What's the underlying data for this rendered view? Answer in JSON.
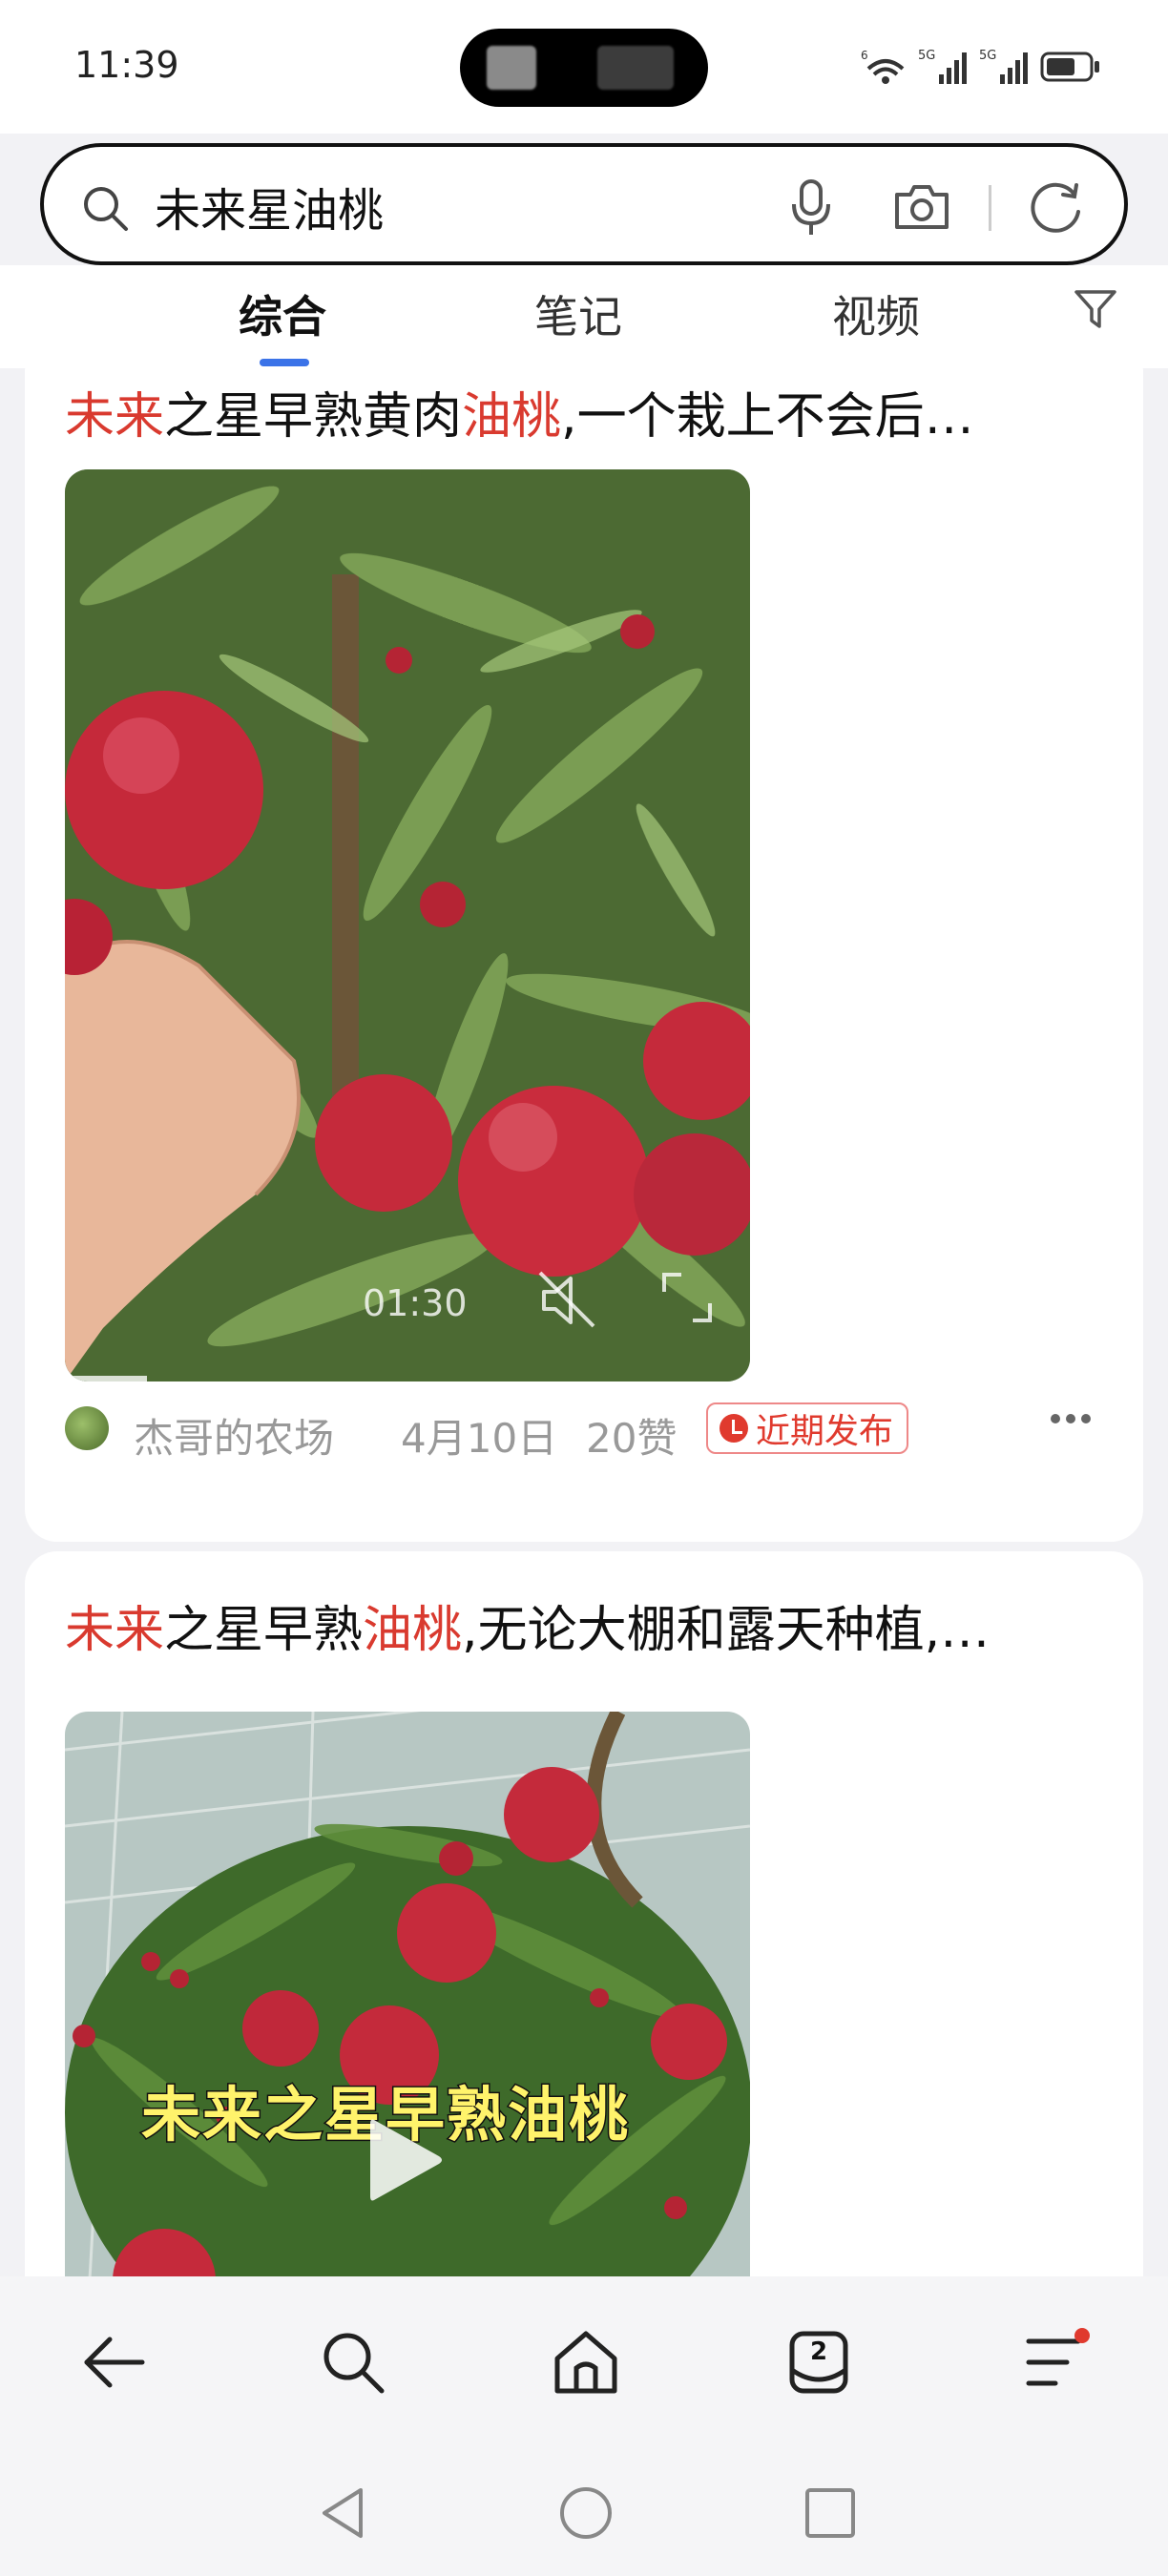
{
  "status_bar": {
    "time": "11:39",
    "network_1": "6",
    "network_2": "5G",
    "network_3": "5G",
    "battery_level": 0.7
  },
  "search": {
    "query": "未来星油桃",
    "placeholder": ""
  },
  "tabs": [
    {
      "label": "综合",
      "active": true
    },
    {
      "label": "笔记",
      "active": false
    },
    {
      "label": "视频",
      "active": false
    }
  ],
  "results": [
    {
      "title_parts": [
        {
          "text": "未来",
          "highlight": true
        },
        {
          "text": "之星早熟黄肉",
          "highlight": false
        },
        {
          "text": "油桃",
          "highlight": true
        },
        {
          "text": ",一个栽上不会后…",
          "highlight": false
        }
      ],
      "duration": "01:30",
      "author": "杰哥的农场",
      "date": "4月10日",
      "likes": "20赞",
      "badge": "近期发布"
    },
    {
      "title_parts": [
        {
          "text": "未来",
          "highlight": true
        },
        {
          "text": "之星早熟",
          "highlight": false
        },
        {
          "text": "油桃",
          "highlight": true
        },
        {
          "text": ",无论大棚和露天种植,…",
          "highlight": false
        }
      ],
      "overlay_text": "未来之星早熟油桃"
    }
  ],
  "bottom_nav": {
    "tab_count": "2"
  },
  "colors": {
    "highlight": "#d93a2f",
    "tab_indicator": "#3b73e8",
    "badge": "#e03a2e"
  }
}
